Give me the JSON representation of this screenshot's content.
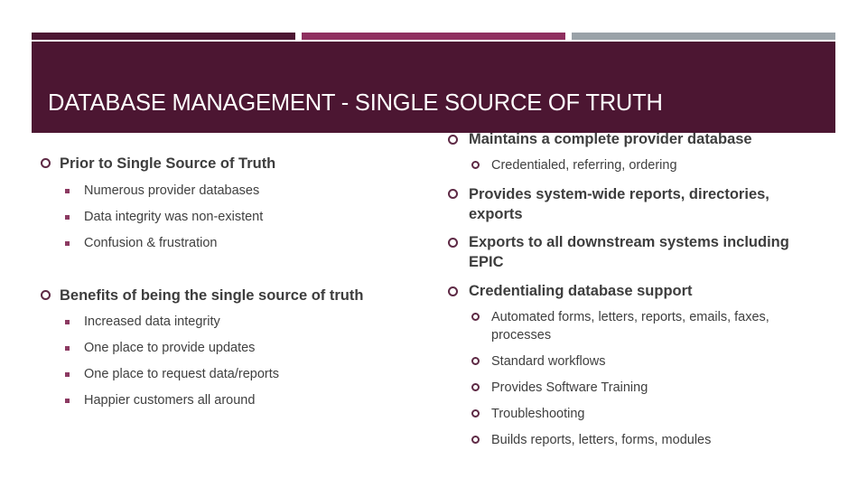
{
  "slide": {
    "title": "DATABASE MANAGEMENT - SINGLE SOURCE OF TRUTH",
    "colors": {
      "header_bg": "#4c1632",
      "accent_bar_1": "#4c1632",
      "accent_bar_2": "#8f2f5f",
      "accent_bar_3": "#9aa2a8",
      "bullet": "#5e2a45"
    }
  },
  "left_column": {
    "sections": [
      {
        "heading": "Prior to Single Source of Truth",
        "bullet_icon": "circle-bullet-icon",
        "items": [
          "Numerous provider databases",
          "Data integrity was non-existent",
          "Confusion & frustration"
        ],
        "item_bullet_icon": "square-bullet-icon"
      },
      {
        "heading": "Benefits of being the single source of truth",
        "bullet_icon": "circle-bullet-icon",
        "items": [
          "Increased data integrity",
          "One place to provide updates",
          "One place to request data/reports",
          "Happier customers all around"
        ],
        "item_bullet_icon": "square-bullet-icon"
      }
    ]
  },
  "right_column": {
    "sections": [
      {
        "heading": "Maintains a complete provider database",
        "items": [
          "Credentialed, referring, ordering"
        ]
      },
      {
        "heading_line1": "Provides system-wide reports, directories,",
        "heading_line2": "exports",
        "items": []
      },
      {
        "heading_line1": "Exports to all downstream systems including",
        "heading_line2": "EPIC",
        "items": []
      },
      {
        "heading": "Credentialing database support",
        "items": [
          {
            "line1": "Automated forms, letters, reports, emails, faxes,",
            "line2": "processes"
          },
          {
            "line1": "Standard workflows"
          },
          {
            "line1": "Provides Software Training"
          },
          {
            "line1": "Troubleshooting"
          },
          {
            "line1": "Builds reports, letters, forms, modules"
          }
        ]
      }
    ]
  }
}
